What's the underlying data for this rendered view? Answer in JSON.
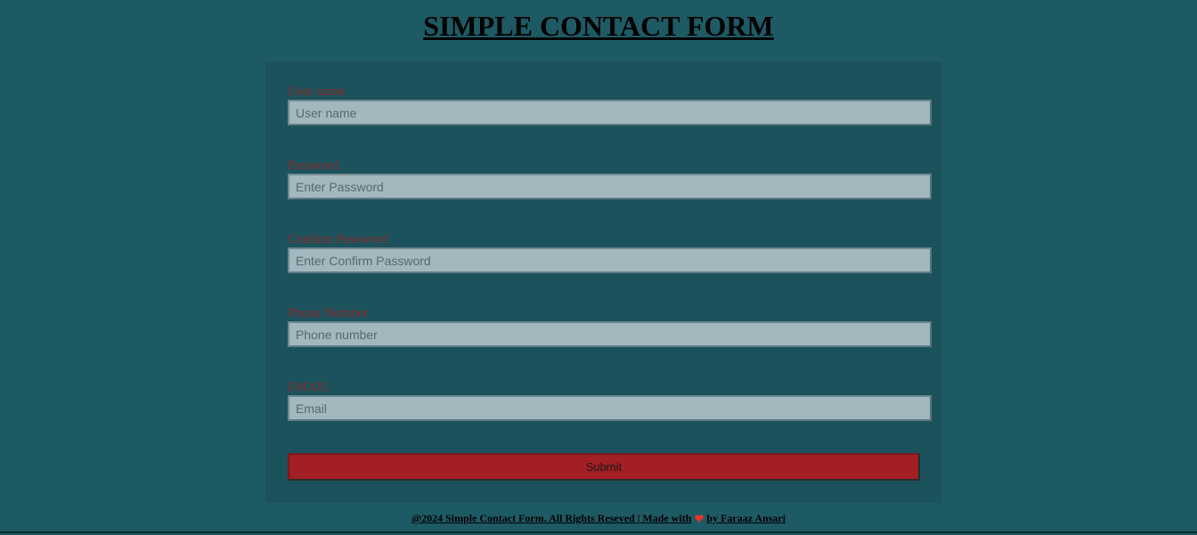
{
  "page": {
    "title": "SIMPLE CONTACT FORM"
  },
  "form": {
    "fields": [
      {
        "label": "User name",
        "placeholder": "User name",
        "type": "text"
      },
      {
        "label": "Password",
        "placeholder": "Enter Password",
        "type": "password"
      },
      {
        "label": "Confirm Password",
        "placeholder": "Enter Confirm Password",
        "type": "password"
      },
      {
        "label": "Phone Number",
        "placeholder": "Phone number",
        "type": "tel"
      },
      {
        "label": "EMAIL",
        "placeholder": "Email",
        "type": "email"
      }
    ],
    "submit_label": "Submit"
  },
  "footer": {
    "text_before": "@2024 Simple Contact Form. All Rights Reseved | Made with",
    "icon": "heart-icon",
    "text_after": "by Faraaz Ansari"
  },
  "colors": {
    "page_background": "#1e5a64",
    "card_background": "#1c525c",
    "label": "#8a2a2a",
    "input_background": "#a2b8be",
    "submit_background": "#a21f24",
    "heart": "#e8322e"
  }
}
